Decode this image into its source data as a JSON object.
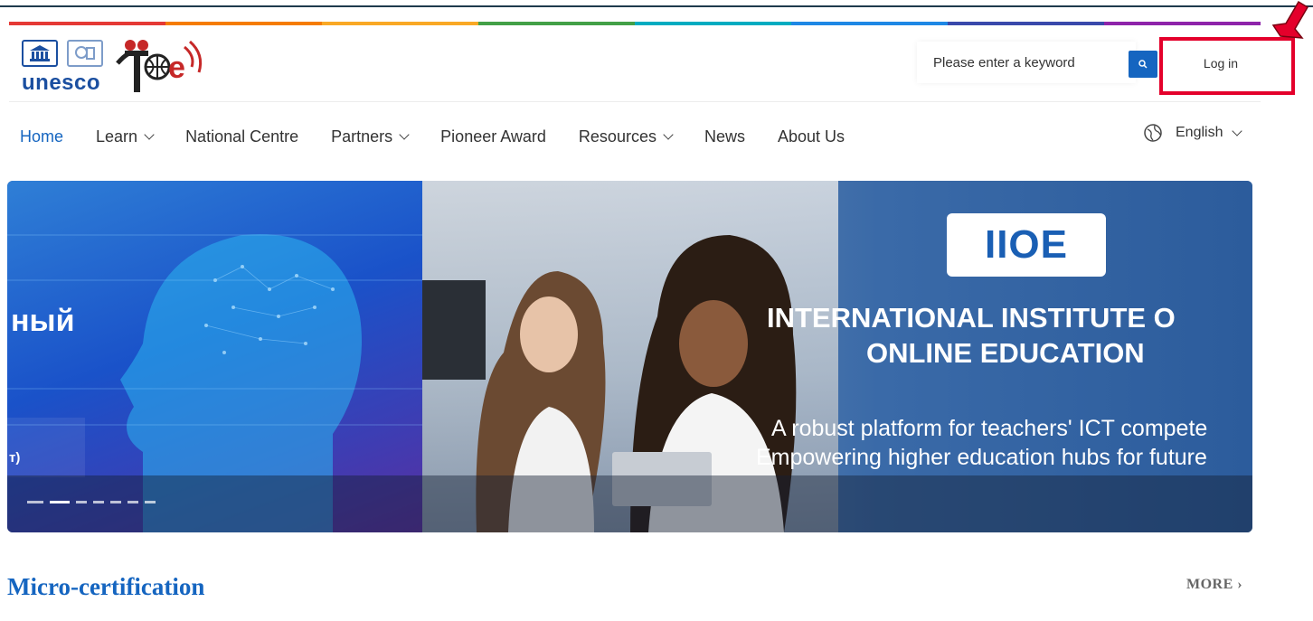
{
  "colors": {
    "rainbow": [
      "#e53935",
      "#f57c00",
      "#f9a825",
      "#43a047",
      "#00acc1",
      "#1e88e5",
      "#3949ab",
      "#8e24aa"
    ],
    "accent": "#1565c0",
    "highlight": "#e4002b"
  },
  "header": {
    "unesco_label": "unesco",
    "logo_brand": "e",
    "search_placeholder": "Please enter a keyword",
    "search_icon": "search-icon",
    "login_label": "Log in"
  },
  "nav": {
    "items": [
      {
        "label": "Home",
        "active": true,
        "dropdown": false
      },
      {
        "label": "Learn",
        "active": false,
        "dropdown": true
      },
      {
        "label": "National Centre",
        "active": false,
        "dropdown": false
      },
      {
        "label": "Partners",
        "active": false,
        "dropdown": true
      },
      {
        "label": "Pioneer Award",
        "active": false,
        "dropdown": false
      },
      {
        "label": "Resources",
        "active": false,
        "dropdown": true
      },
      {
        "label": "News",
        "active": false,
        "dropdown": false
      },
      {
        "label": "About Us",
        "active": false,
        "dropdown": false
      }
    ],
    "language": "English"
  },
  "banner": {
    "left_text_1": "ный",
    "left_text_2": "т)",
    "badge": "IIOE",
    "title_line_1": "INTERNATIONAL INSTITUTE O",
    "title_line_2": "ONLINE EDUCATION",
    "sub_line_1": "A robust platform for teachers' ICT compete",
    "sub_line_2": "Empowering higher education hubs for future",
    "slide_count": 7,
    "active_slide": 1
  },
  "section": {
    "title": "Micro-certification",
    "more_label": "MORE ›"
  }
}
